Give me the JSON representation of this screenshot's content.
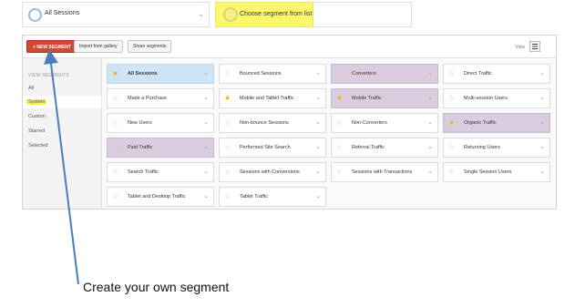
{
  "segment_bar": {
    "slot1": "All Sessions",
    "slot2": "Choose segment from list"
  },
  "toolbar": {
    "new_segment": "+ NEW SEGMENT",
    "import_gallery": "Import from gallery",
    "share_segments": "Share segments",
    "view_label": "View"
  },
  "sidebar": {
    "heading": "VIEW SEGMENTS",
    "items": [
      "All",
      "System",
      "Custom",
      "Starred",
      "Selected"
    ],
    "active": "System"
  },
  "segments": [
    {
      "label": "All Sessions",
      "starred": true,
      "style": "blue",
      "bold": true
    },
    {
      "label": "Bounced Sessions",
      "starred": false,
      "style": "plain"
    },
    {
      "label": "Converters",
      "starred": false,
      "style": "purple"
    },
    {
      "label": "Direct Traffic",
      "starred": false,
      "style": "plain"
    },
    {
      "label": "Made a Purchase",
      "starred": false,
      "style": "plain"
    },
    {
      "label": "Mobile and Tablet Traffic",
      "starred": true,
      "style": "plain"
    },
    {
      "label": "Mobile Traffic",
      "starred": true,
      "style": "purple"
    },
    {
      "label": "Multi-session Users",
      "starred": false,
      "style": "plain"
    },
    {
      "label": "New Users",
      "starred": false,
      "style": "plain"
    },
    {
      "label": "Non-bounce Sessions",
      "starred": false,
      "style": "plain"
    },
    {
      "label": "Non-Converters",
      "starred": false,
      "style": "plain"
    },
    {
      "label": "Organic Traffic",
      "starred": true,
      "style": "purple"
    },
    {
      "label": "Paid Traffic",
      "starred": false,
      "style": "purple"
    },
    {
      "label": "Performed Site Search",
      "starred": false,
      "style": "plain"
    },
    {
      "label": "Referral Traffic",
      "starred": false,
      "style": "plain"
    },
    {
      "label": "Returning Users",
      "starred": false,
      "style": "plain"
    },
    {
      "label": "Search Traffic",
      "starred": false,
      "style": "plain"
    },
    {
      "label": "Sessions with Conversions",
      "starred": false,
      "style": "plain"
    },
    {
      "label": "Sessions with Transactions",
      "starred": false,
      "style": "plain"
    },
    {
      "label": "Single Session Users",
      "starred": false,
      "style": "plain"
    },
    {
      "label": "Tablet and Desktop Traffic",
      "starred": false,
      "style": "plain"
    },
    {
      "label": "Tablet Traffic",
      "starred": false,
      "style": "plain"
    }
  ],
  "annotation": {
    "caption": "Create your own segment",
    "arrow_color": "#4a7ebb"
  },
  "colors": {
    "highlight": "#f6f25a",
    "new_button": "#d14836",
    "selected_blue": "#cfe5f5",
    "selected_purple": "#d9ccde",
    "star_on": "#f0b400"
  }
}
